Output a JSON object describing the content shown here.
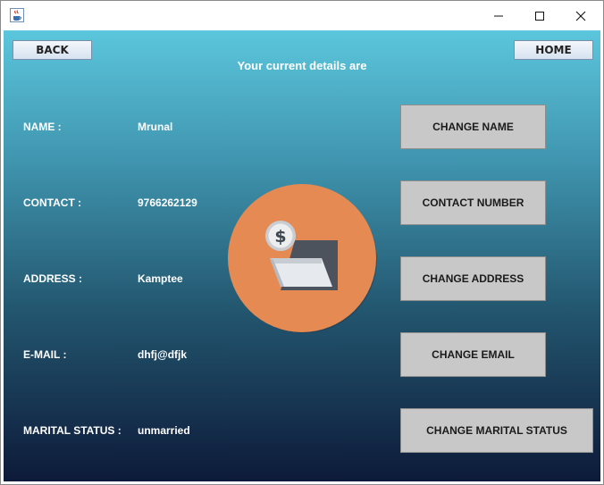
{
  "window": {
    "app_icon": "java-coffee-icon",
    "controls": [
      "minimize-icon",
      "maximize-icon",
      "close-icon"
    ]
  },
  "toolbar": {
    "back_label": "BACK",
    "home_label": "HOME"
  },
  "subtitle": "Your current details are",
  "fields": [
    {
      "label": "NAME :",
      "value": "Mrunal"
    },
    {
      "label": "CONTACT :",
      "value": "9766262129"
    },
    {
      "label": "ADDRESS  :",
      "value": "Kamptee"
    },
    {
      "label": "E-MAIL :",
      "value": "dhfj@dfjk"
    },
    {
      "label": "MARITAL STATUS :",
      "value": "unmarried"
    }
  ],
  "actions": [
    {
      "label": "CHANGE NAME"
    },
    {
      "label": "CONTACT NUMBER"
    },
    {
      "label": "CHANGE ADDRESS"
    },
    {
      "label": "CHANGE EMAIL"
    },
    {
      "label": "CHANGE MARITAL STATUS"
    }
  ],
  "logo": {
    "icon": "wallet-dollar-icon",
    "color": "#e58a52",
    "coin_symbol": "$"
  },
  "colors": {
    "gradient_top": "#5bc6dc",
    "gradient_bottom": "#0d1a39",
    "button_gray": "#c8c8c8"
  }
}
